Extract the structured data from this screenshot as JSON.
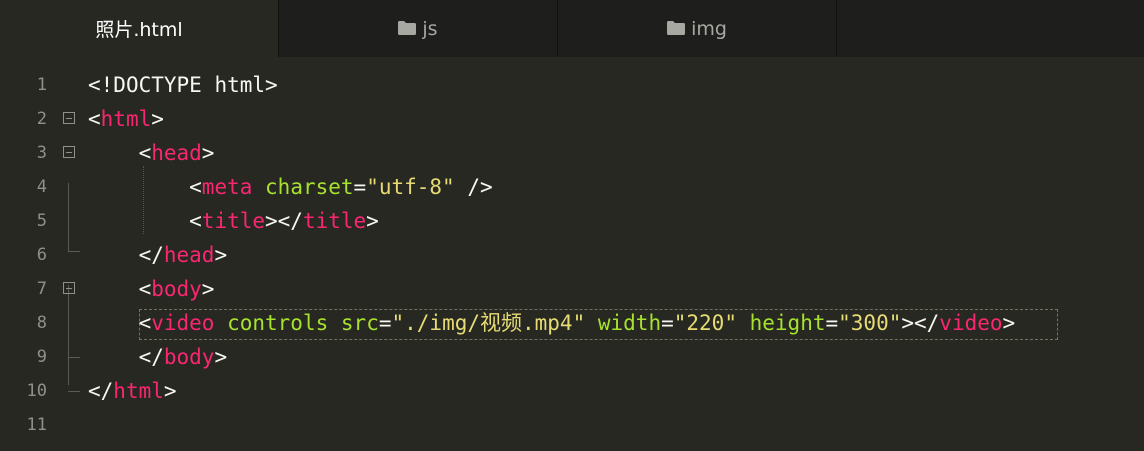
{
  "tabs": [
    {
      "label": "照片.html",
      "icon": "",
      "active": true
    },
    {
      "label": "js",
      "icon": "folder-icon",
      "active": false
    },
    {
      "label": "img",
      "icon": "folder-icon",
      "active": false
    }
  ],
  "lines": [
    {
      "num": "1",
      "tokens": [
        {
          "c": "p",
          "t": "<!"
        },
        {
          "c": "p",
          "t": "DOCTYPE html"
        },
        {
          "c": "p",
          "t": ">"
        }
      ]
    },
    {
      "num": "2",
      "tokens": [
        {
          "c": "p",
          "t": "<"
        },
        {
          "c": "t",
          "t": "html"
        },
        {
          "c": "p",
          "t": ">"
        }
      ]
    },
    {
      "num": "3",
      "tokens": [
        {
          "c": "p",
          "t": "    <"
        },
        {
          "c": "t",
          "t": "head"
        },
        {
          "c": "p",
          "t": ">"
        }
      ]
    },
    {
      "num": "4",
      "tokens": [
        {
          "c": "p",
          "t": "        <"
        },
        {
          "c": "t",
          "t": "meta"
        },
        {
          "c": "p",
          "t": " "
        },
        {
          "c": "a",
          "t": "charset"
        },
        {
          "c": "p",
          "t": "="
        },
        {
          "c": "s",
          "t": "\"utf-8\""
        },
        {
          "c": "p",
          "t": " />"
        }
      ]
    },
    {
      "num": "5",
      "tokens": [
        {
          "c": "p",
          "t": "        <"
        },
        {
          "c": "t",
          "t": "title"
        },
        {
          "c": "p",
          "t": "></"
        },
        {
          "c": "t",
          "t": "title"
        },
        {
          "c": "p",
          "t": ">"
        }
      ]
    },
    {
      "num": "6",
      "tokens": [
        {
          "c": "p",
          "t": "    </"
        },
        {
          "c": "t",
          "t": "head"
        },
        {
          "c": "p",
          "t": ">"
        }
      ]
    },
    {
      "num": "7",
      "tokens": [
        {
          "c": "p",
          "t": "    <"
        },
        {
          "c": "t",
          "t": "body"
        },
        {
          "c": "p",
          "t": ">"
        }
      ]
    },
    {
      "num": "8",
      "tokens": [
        {
          "c": "p",
          "t": "    <"
        },
        {
          "c": "t",
          "t": "video"
        },
        {
          "c": "p",
          "t": " "
        },
        {
          "c": "a",
          "t": "controls"
        },
        {
          "c": "p",
          "t": " "
        },
        {
          "c": "a",
          "t": "src"
        },
        {
          "c": "p",
          "t": "="
        },
        {
          "c": "s",
          "t": "\"./img/视频.mp4\""
        },
        {
          "c": "p",
          "t": " "
        },
        {
          "c": "a",
          "t": "width"
        },
        {
          "c": "p",
          "t": "="
        },
        {
          "c": "s",
          "t": "\"220\""
        },
        {
          "c": "p",
          "t": " "
        },
        {
          "c": "a",
          "t": "height"
        },
        {
          "c": "p",
          "t": "="
        },
        {
          "c": "s",
          "t": "\"300\""
        },
        {
          "c": "p",
          "t": "></"
        },
        {
          "c": "t",
          "t": "video"
        },
        {
          "c": "p",
          "t": ">"
        }
      ]
    },
    {
      "num": "9",
      "tokens": [
        {
          "c": "p",
          "t": "    </"
        },
        {
          "c": "t",
          "t": "body"
        },
        {
          "c": "p",
          "t": ">"
        }
      ]
    },
    {
      "num": "10",
      "tokens": [
        {
          "c": "p",
          "t": "</"
        },
        {
          "c": "t",
          "t": "html"
        },
        {
          "c": "p",
          "t": ">"
        }
      ]
    },
    {
      "num": "11",
      "tokens": []
    }
  ],
  "colors": {
    "background": "#272822",
    "tag": "#f92672",
    "attribute": "#a6e22e",
    "string": "#e6db74",
    "plain": "#f8f8f2",
    "line_number": "#8f908a"
  },
  "fold_lines": [
    "2",
    "3",
    "7"
  ]
}
